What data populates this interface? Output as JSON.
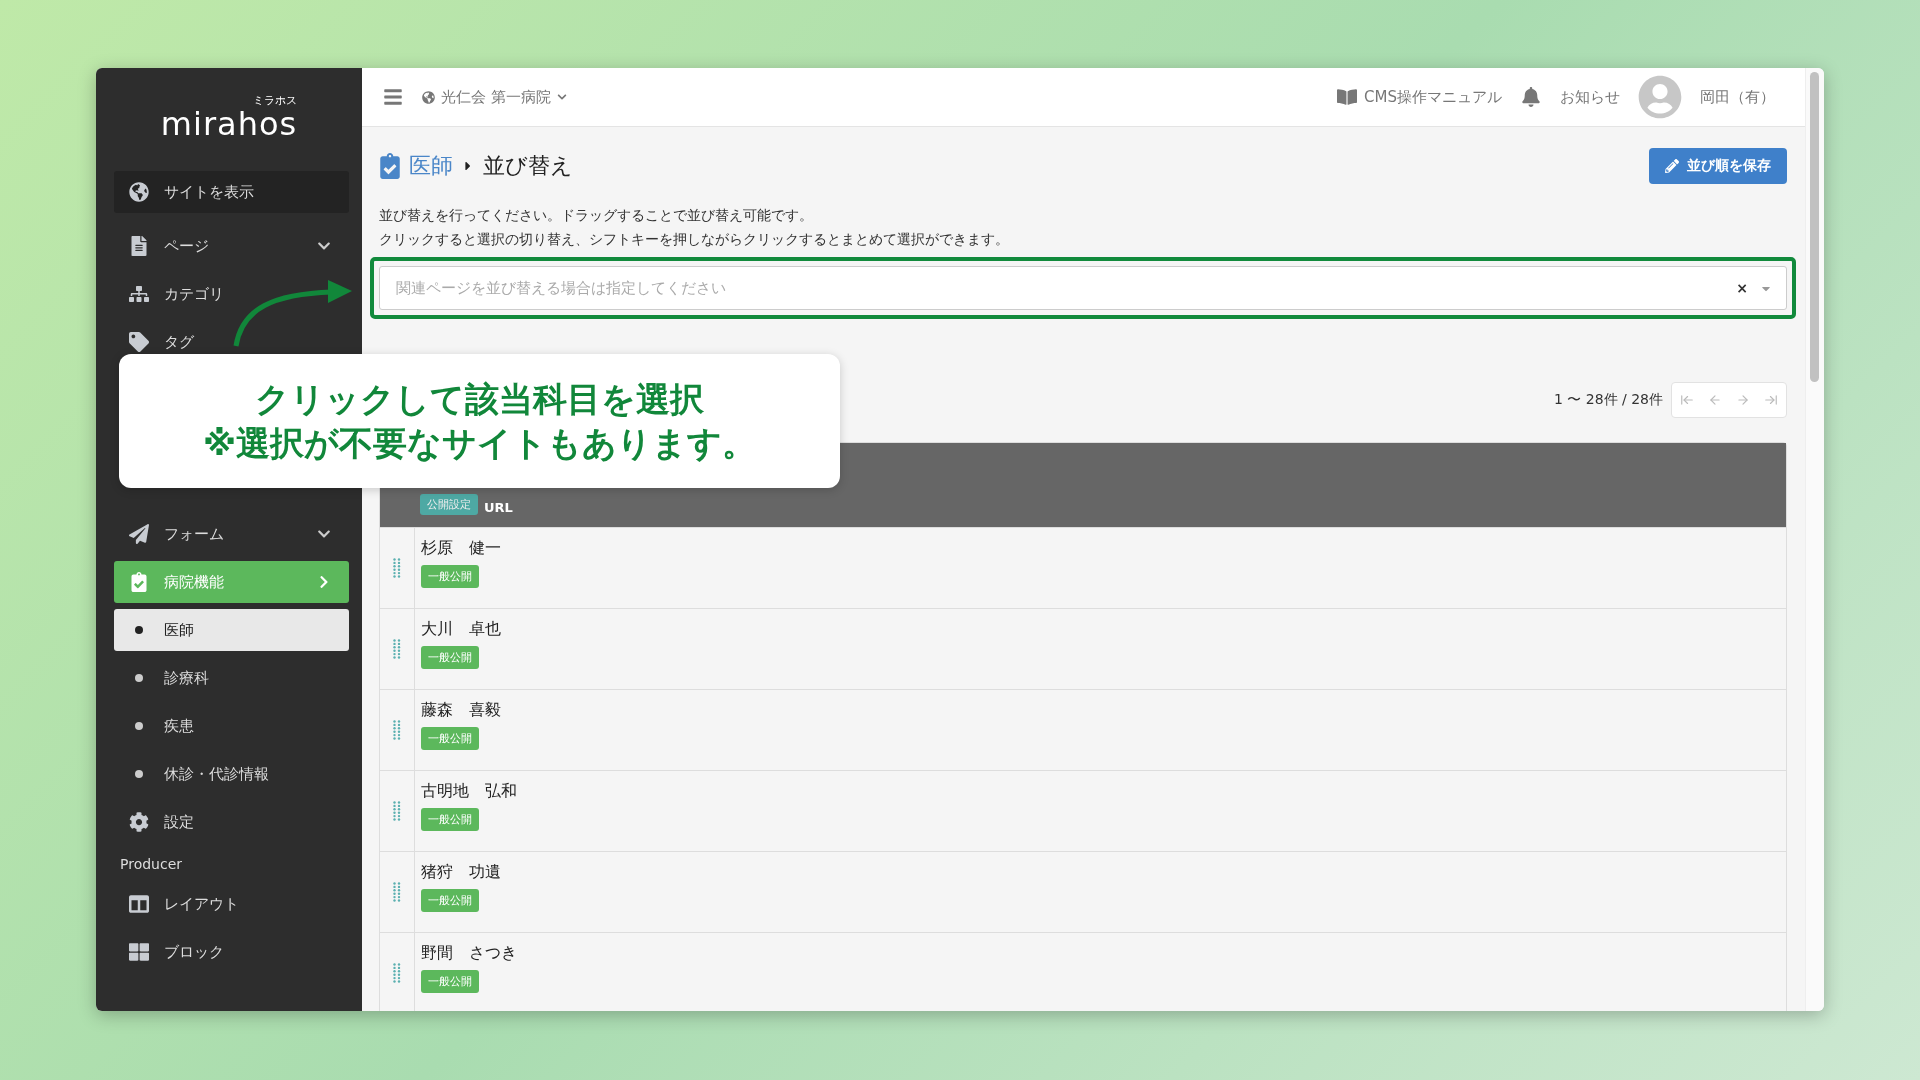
{
  "logo": {
    "text": "mirahos",
    "ruby": "ミラホス"
  },
  "sidebar": {
    "view_site": "サイトを表示",
    "items": [
      {
        "label": "ページ",
        "expanded": false,
        "selected": false
      },
      {
        "label": "カテゴリ",
        "selected": false
      },
      {
        "label": "タグ",
        "selected": false
      },
      {
        "label": "フォーム",
        "expanded": false,
        "selected": false
      },
      {
        "label": "病院機能",
        "expanded": true,
        "selected": true,
        "children": [
          {
            "label": "医師",
            "selected": true
          },
          {
            "label": "診療科",
            "selected": false
          },
          {
            "label": "疾患",
            "selected": false
          },
          {
            "label": "休診・代診情報",
            "selected": false
          }
        ]
      },
      {
        "label": "設定",
        "selected": false
      }
    ],
    "section": "Producer",
    "producer_items": [
      {
        "label": "レイアウト",
        "selected": false
      },
      {
        "label": "ブロック",
        "selected": false
      }
    ]
  },
  "header": {
    "site": "光仁会 第一病院",
    "manual": "CMS操作マニュアル",
    "notices": "お知らせ",
    "user": "岡田（有）"
  },
  "page": {
    "breadcrumb": [
      "医師",
      "並び替え"
    ],
    "save_button": "並び順を保存",
    "instructions": [
      "並び替えを行ってください。ドラッグすることで並び替え可能です。",
      "クリックすると選択の切り替え、シフトキーを押しながらクリックするとまとめて選択ができます。"
    ],
    "related_select": {
      "placeholder": "関連ページを並び替える場合は指定してください",
      "clear": "×"
    },
    "pagination": "1 〜 28件 / 28件",
    "table": {
      "header_badge": "公開設定",
      "header_column": "URL",
      "rows": [
        {
          "name": "杉原　健一",
          "status": "一般公開"
        },
        {
          "name": "大川　卓也",
          "status": "一般公開"
        },
        {
          "name": "藤森　喜毅",
          "status": "一般公開"
        },
        {
          "name": "古明地　弘和",
          "status": "一般公開"
        },
        {
          "name": "猪狩　功遺",
          "status": "一般公開"
        },
        {
          "name": "野間　さつき",
          "status": "一般公開"
        }
      ]
    }
  },
  "callout": {
    "lines": [
      "クリックして該当科目を選択",
      "※選択が不要なサイトもあります。"
    ]
  }
}
